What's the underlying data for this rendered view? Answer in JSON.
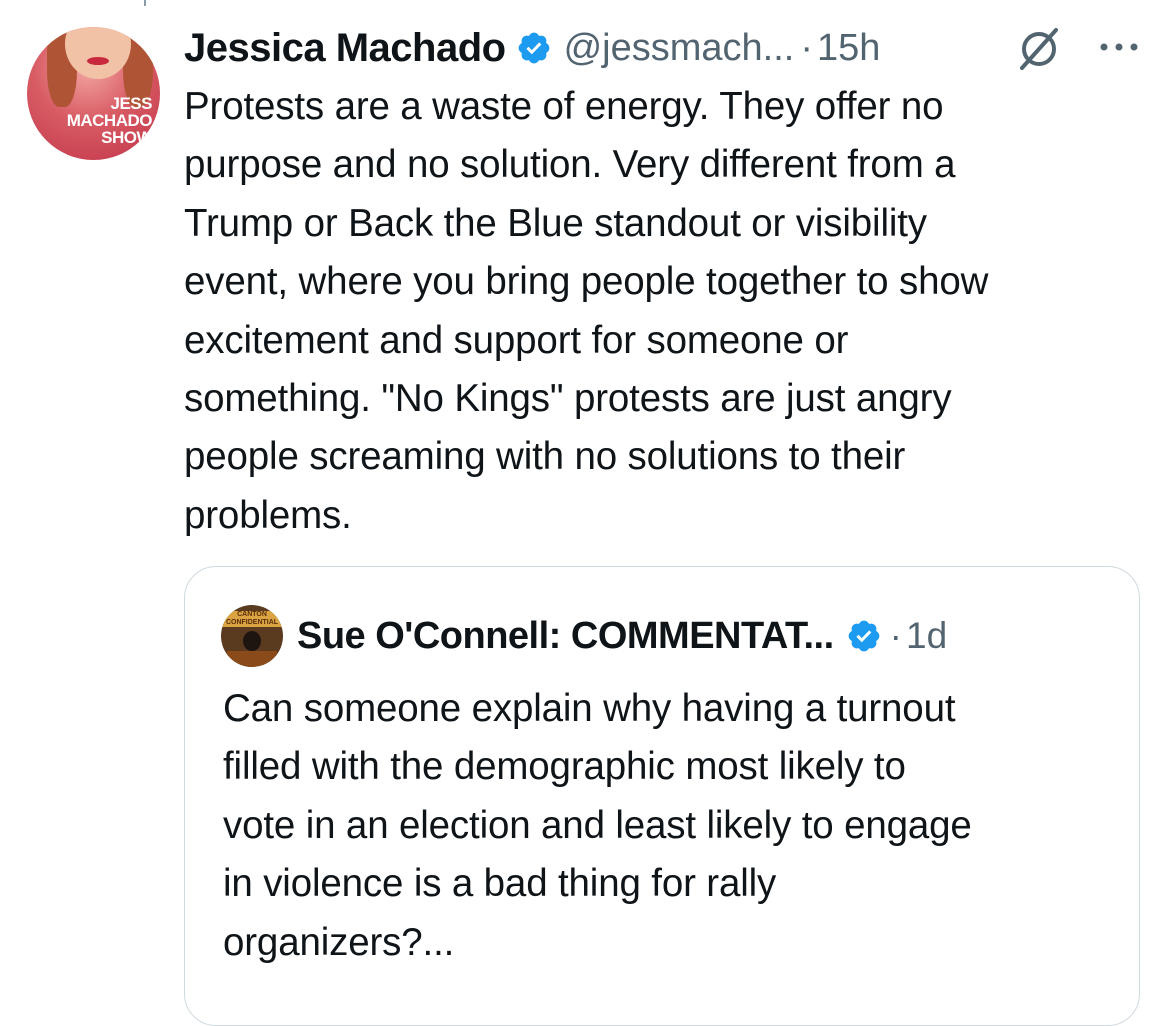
{
  "post": {
    "author": {
      "name": "Jessica Machado",
      "handle": "@jessmach...",
      "avatar_label": "JESS\nMACHADO\nSHOW",
      "verified": true
    },
    "separator": "·",
    "time": "15h",
    "text": "Protests are a waste of energy.  They offer no\npurpose and no solution. Very different from a\nTrump or Back the Blue standout or visibility\nevent, where you bring people together to show\nexcitement and support for someone or\nsomething.  \"No Kings\" protests are just angry\npeople screaming with no solutions to their\nproblems.",
    "icons": {
      "grok": "grok-icon",
      "more": "more-icon",
      "verified": "verified-badge-icon"
    }
  },
  "quote": {
    "author": {
      "name": "Sue O'Connell: COMMENTAT...",
      "avatar_label": "CANTON\nCONFIDENTIAL",
      "verified": true
    },
    "separator": "·",
    "time": "1d",
    "text": "Can someone explain why having a turnout\nfilled with the demographic most likely to\nvote in an election and least likely to engage\nin violence is a bad thing for rally\norganizers?..."
  },
  "colors": {
    "text_primary": "#0f1419",
    "text_secondary": "#536471",
    "verified_blue": "#1d9bf0",
    "border": "#cfd9de"
  }
}
